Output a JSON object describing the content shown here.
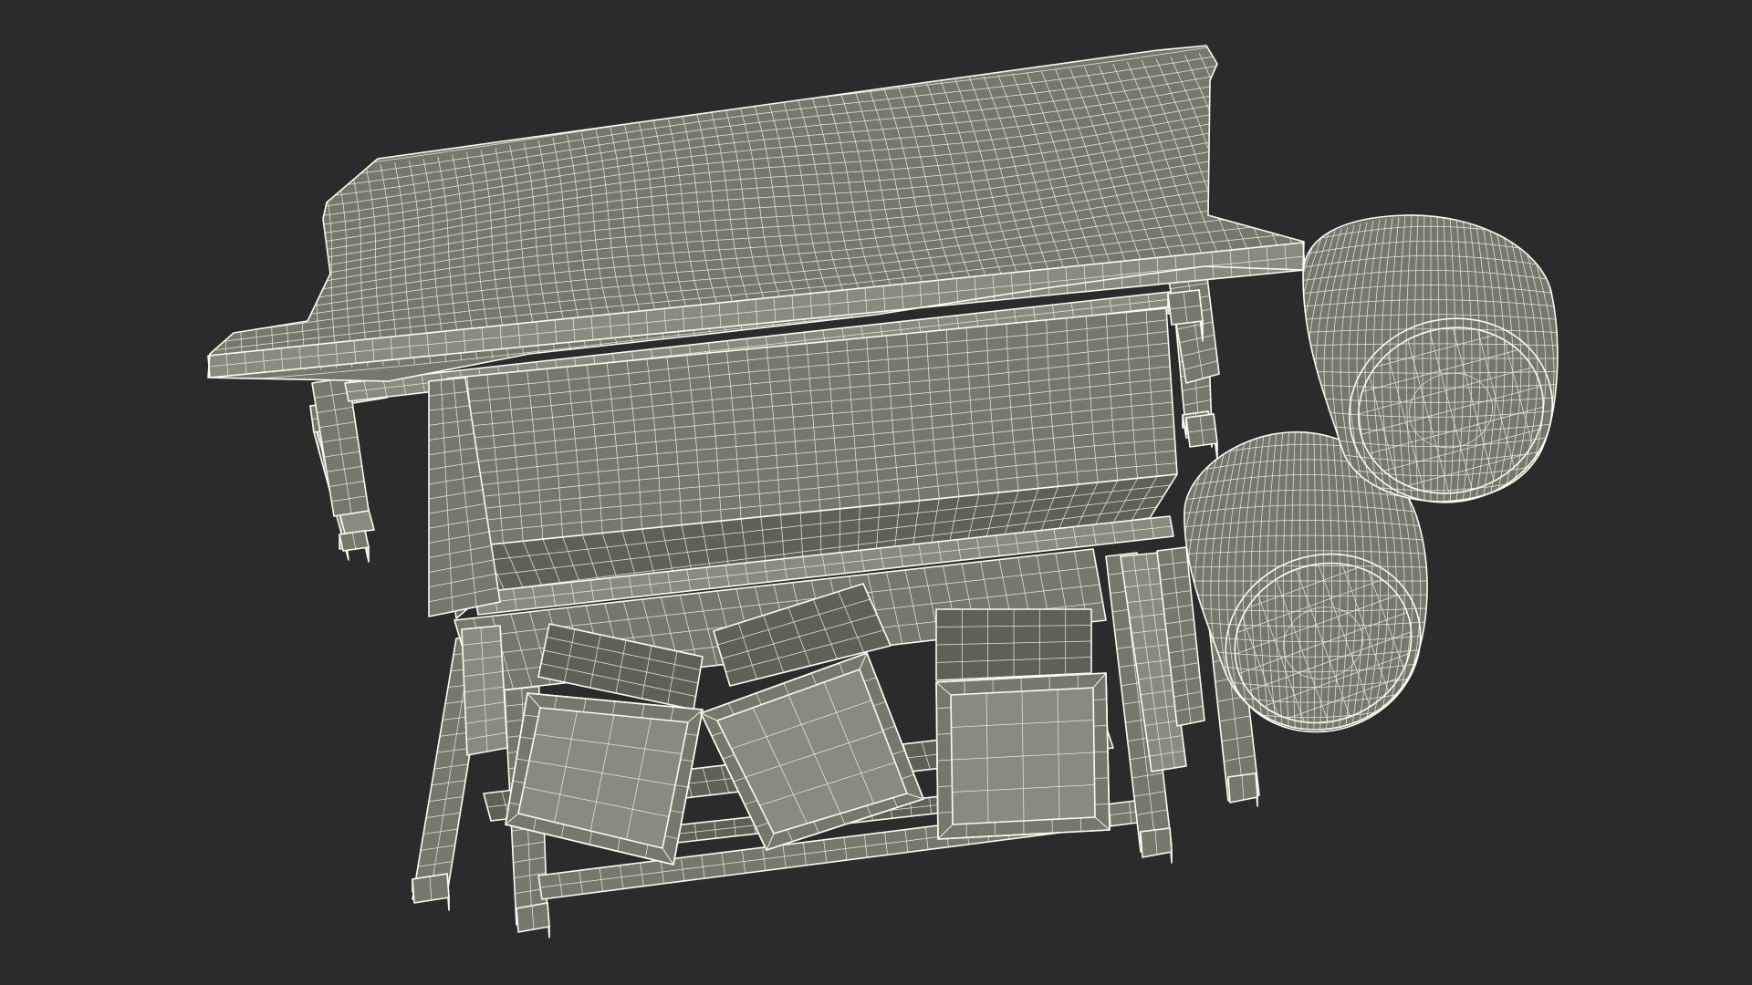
{
  "scene": {
    "subject": "wireframe-render",
    "colors": {
      "background": "#2b2b2b",
      "surface": "#77786c",
      "surface_dark": "#5f6056",
      "surface_light": "#8a8b7f",
      "wire": "#f1f1e6"
    }
  }
}
